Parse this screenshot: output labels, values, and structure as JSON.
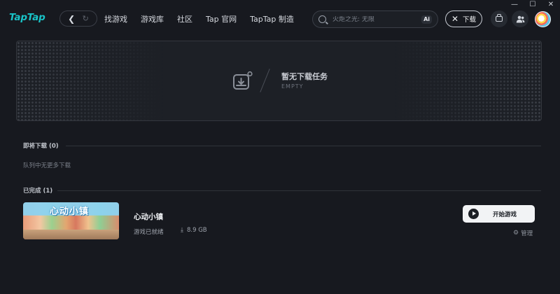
{
  "window": {
    "minimize_glyph": "—",
    "maximize_glyph": "☐",
    "close_glyph": "✕"
  },
  "header": {
    "logo": "TapTap",
    "back_icon": "chevron-left-icon",
    "refresh_icon": "refresh-icon",
    "menu": [
      "找游戏",
      "游戏库",
      "社区",
      "Tap 官网",
      "TapTap 制造"
    ],
    "search": {
      "placeholder": "火炬之光: 无限",
      "ai_label": "Ai"
    },
    "download_button": "下载",
    "inbox_icon": "inbox-icon",
    "friends_icon": "friends-icon",
    "avatar_icon": "avatar-icon"
  },
  "banner": {
    "title": "暂无下载任务",
    "subtitle": "EMPTY",
    "icon": "download-tray-icon"
  },
  "queue": {
    "title": "即将下载 (0)",
    "empty_text": "队列中无更多下载"
  },
  "completed": {
    "title": "已完成 (1)",
    "game": {
      "thumb_logo": "心动小镇",
      "name": "心动小镇",
      "status": "游戏已就绪",
      "size": "8.9 GB",
      "play_label": "开始游戏",
      "manage_label": "管理"
    }
  },
  "colors": {
    "accent": "#19c3c7",
    "background": "#17191f",
    "button_light": "#f2f3f5"
  }
}
